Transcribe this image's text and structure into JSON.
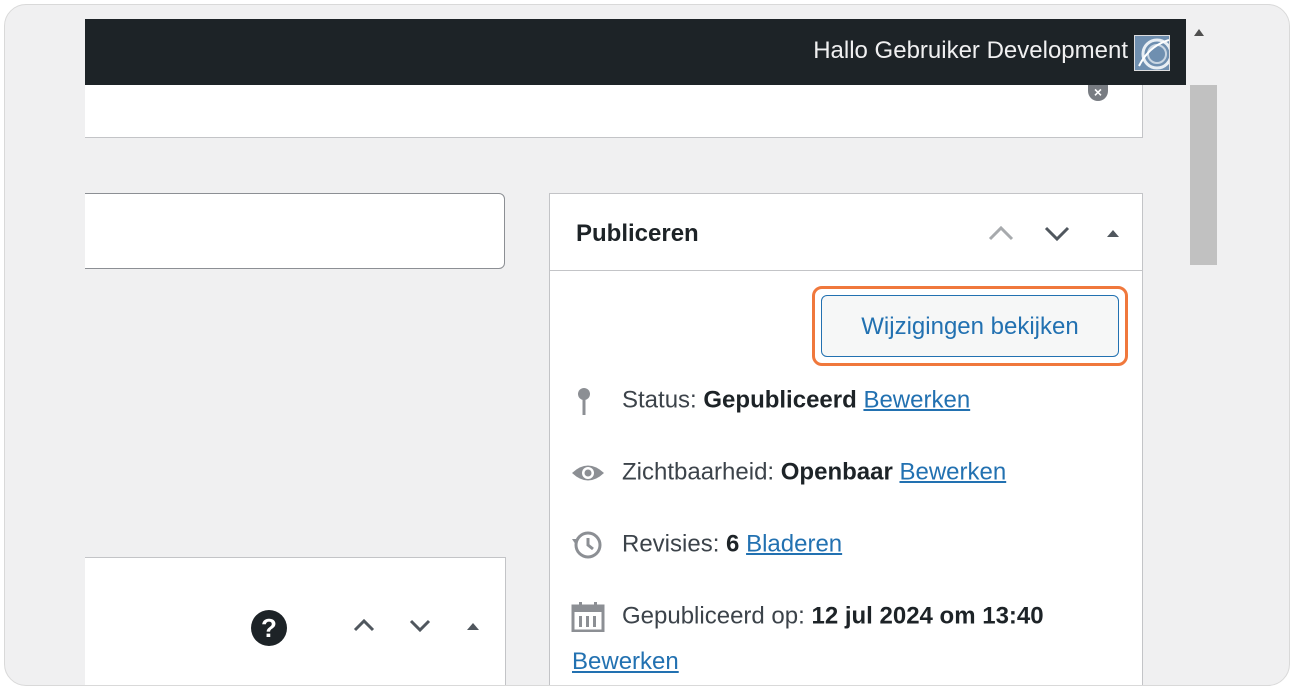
{
  "adminbar": {
    "greeting": "Hallo Gebruiker Development"
  },
  "icons": {
    "avatar": "user-avatar",
    "dismiss": "dismiss-icon",
    "help": "help-icon",
    "pin": "pin-icon",
    "eye": "eye-icon",
    "history": "history-icon",
    "calendar": "calendar-icon"
  },
  "publish": {
    "title": "Publiceren",
    "preview_button": "Wijzigingen bekijken",
    "status": {
      "label": "Status:",
      "value": "Gepubliceerd",
      "link": "Bewerken"
    },
    "visibility": {
      "label": "Zichtbaarheid:",
      "value": "Openbaar",
      "link": "Bewerken"
    },
    "revisions": {
      "label": "Revisies:",
      "value": "6",
      "link": "Bladeren"
    },
    "published": {
      "label": "Gepubliceerd op:",
      "value": "12 jul 2024 om 13:40",
      "link": "Bewerken"
    }
  },
  "colors": {
    "accent": "#2271b1",
    "highlight": "#f0783c",
    "adminbar": "#1d2327"
  }
}
